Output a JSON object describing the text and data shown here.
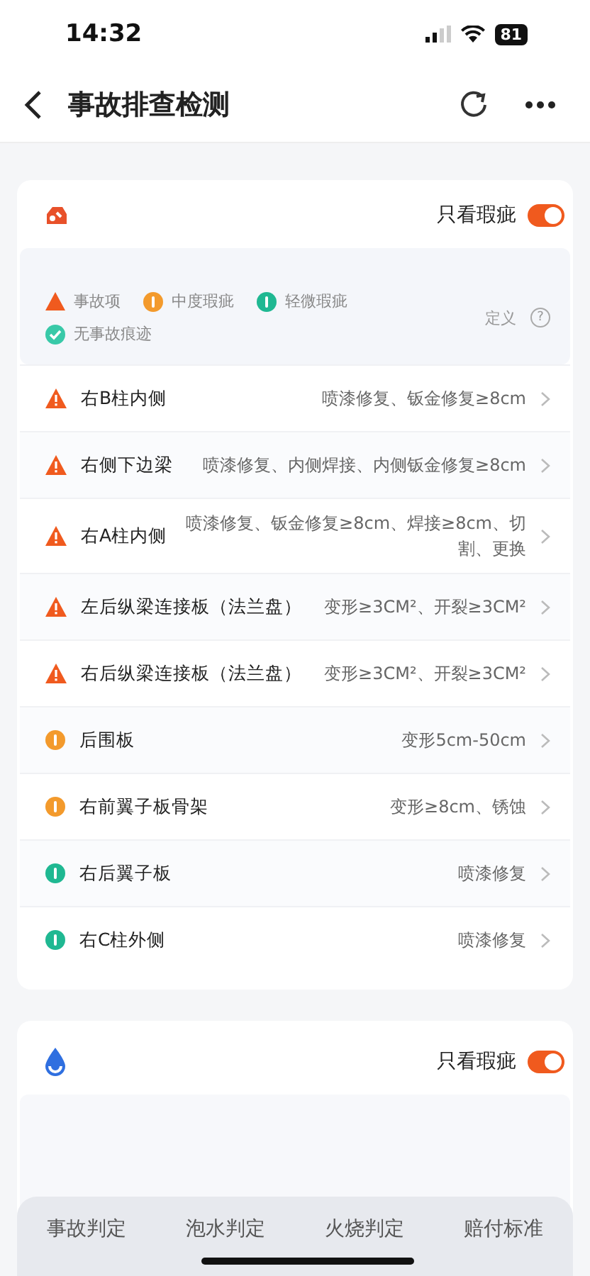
{
  "status_bar": {
    "time": "14:32",
    "battery": "81"
  },
  "nav": {
    "title": "事故排查检测"
  },
  "sections": [
    {
      "kind": "accident",
      "toggle": {
        "label": "只看瑕疵",
        "on": true
      },
      "legend": [
        {
          "kind": "accident",
          "label": "事故项"
        },
        {
          "kind": "moderate",
          "label": "中度瑕疵"
        },
        {
          "kind": "minor",
          "label": "轻微瑕疵"
        },
        {
          "kind": "none",
          "label": "无事故痕迹"
        }
      ],
      "definition": {
        "label": "定义",
        "icon": "?"
      },
      "items": [
        {
          "kind": "accident",
          "name": "右B柱内侧",
          "detail": "喷漆修复、钣金修复≥8cm"
        },
        {
          "kind": "accident",
          "name": "右侧下边梁",
          "detail": "喷漆修复、内侧焊接、内侧钣金修复≥8cm"
        },
        {
          "kind": "accident",
          "name": "右A柱内侧",
          "detail": "喷漆修复、钣金修复≥8cm、焊接≥8cm、切割、更换"
        },
        {
          "kind": "accident",
          "name": "左后纵梁连接板（法兰盘）",
          "detail": "变形≥3CM²、开裂≥3CM²"
        },
        {
          "kind": "accident",
          "name": "右后纵梁连接板（法兰盘）",
          "detail": "变形≥3CM²、开裂≥3CM²"
        },
        {
          "kind": "moderate",
          "name": "后围板",
          "detail": "变形5cm-50cm"
        },
        {
          "kind": "moderate",
          "name": "右前翼子板骨架",
          "detail": "变形≥8cm、锈蚀"
        },
        {
          "kind": "minor",
          "name": "右后翼子板",
          "detail": "喷漆修复"
        },
        {
          "kind": "minor",
          "name": "右C柱外侧",
          "detail": "喷漆修复"
        }
      ]
    },
    {
      "kind": "water",
      "toggle": {
        "label": "只看瑕疵",
        "on": true
      }
    }
  ],
  "bottom_tabs": [
    {
      "label": "事故判定",
      "selected": false
    },
    {
      "label": "泡水判定",
      "selected": false
    },
    {
      "label": "火烧判定",
      "selected": false
    },
    {
      "label": "赔付标准",
      "selected": false
    }
  ]
}
